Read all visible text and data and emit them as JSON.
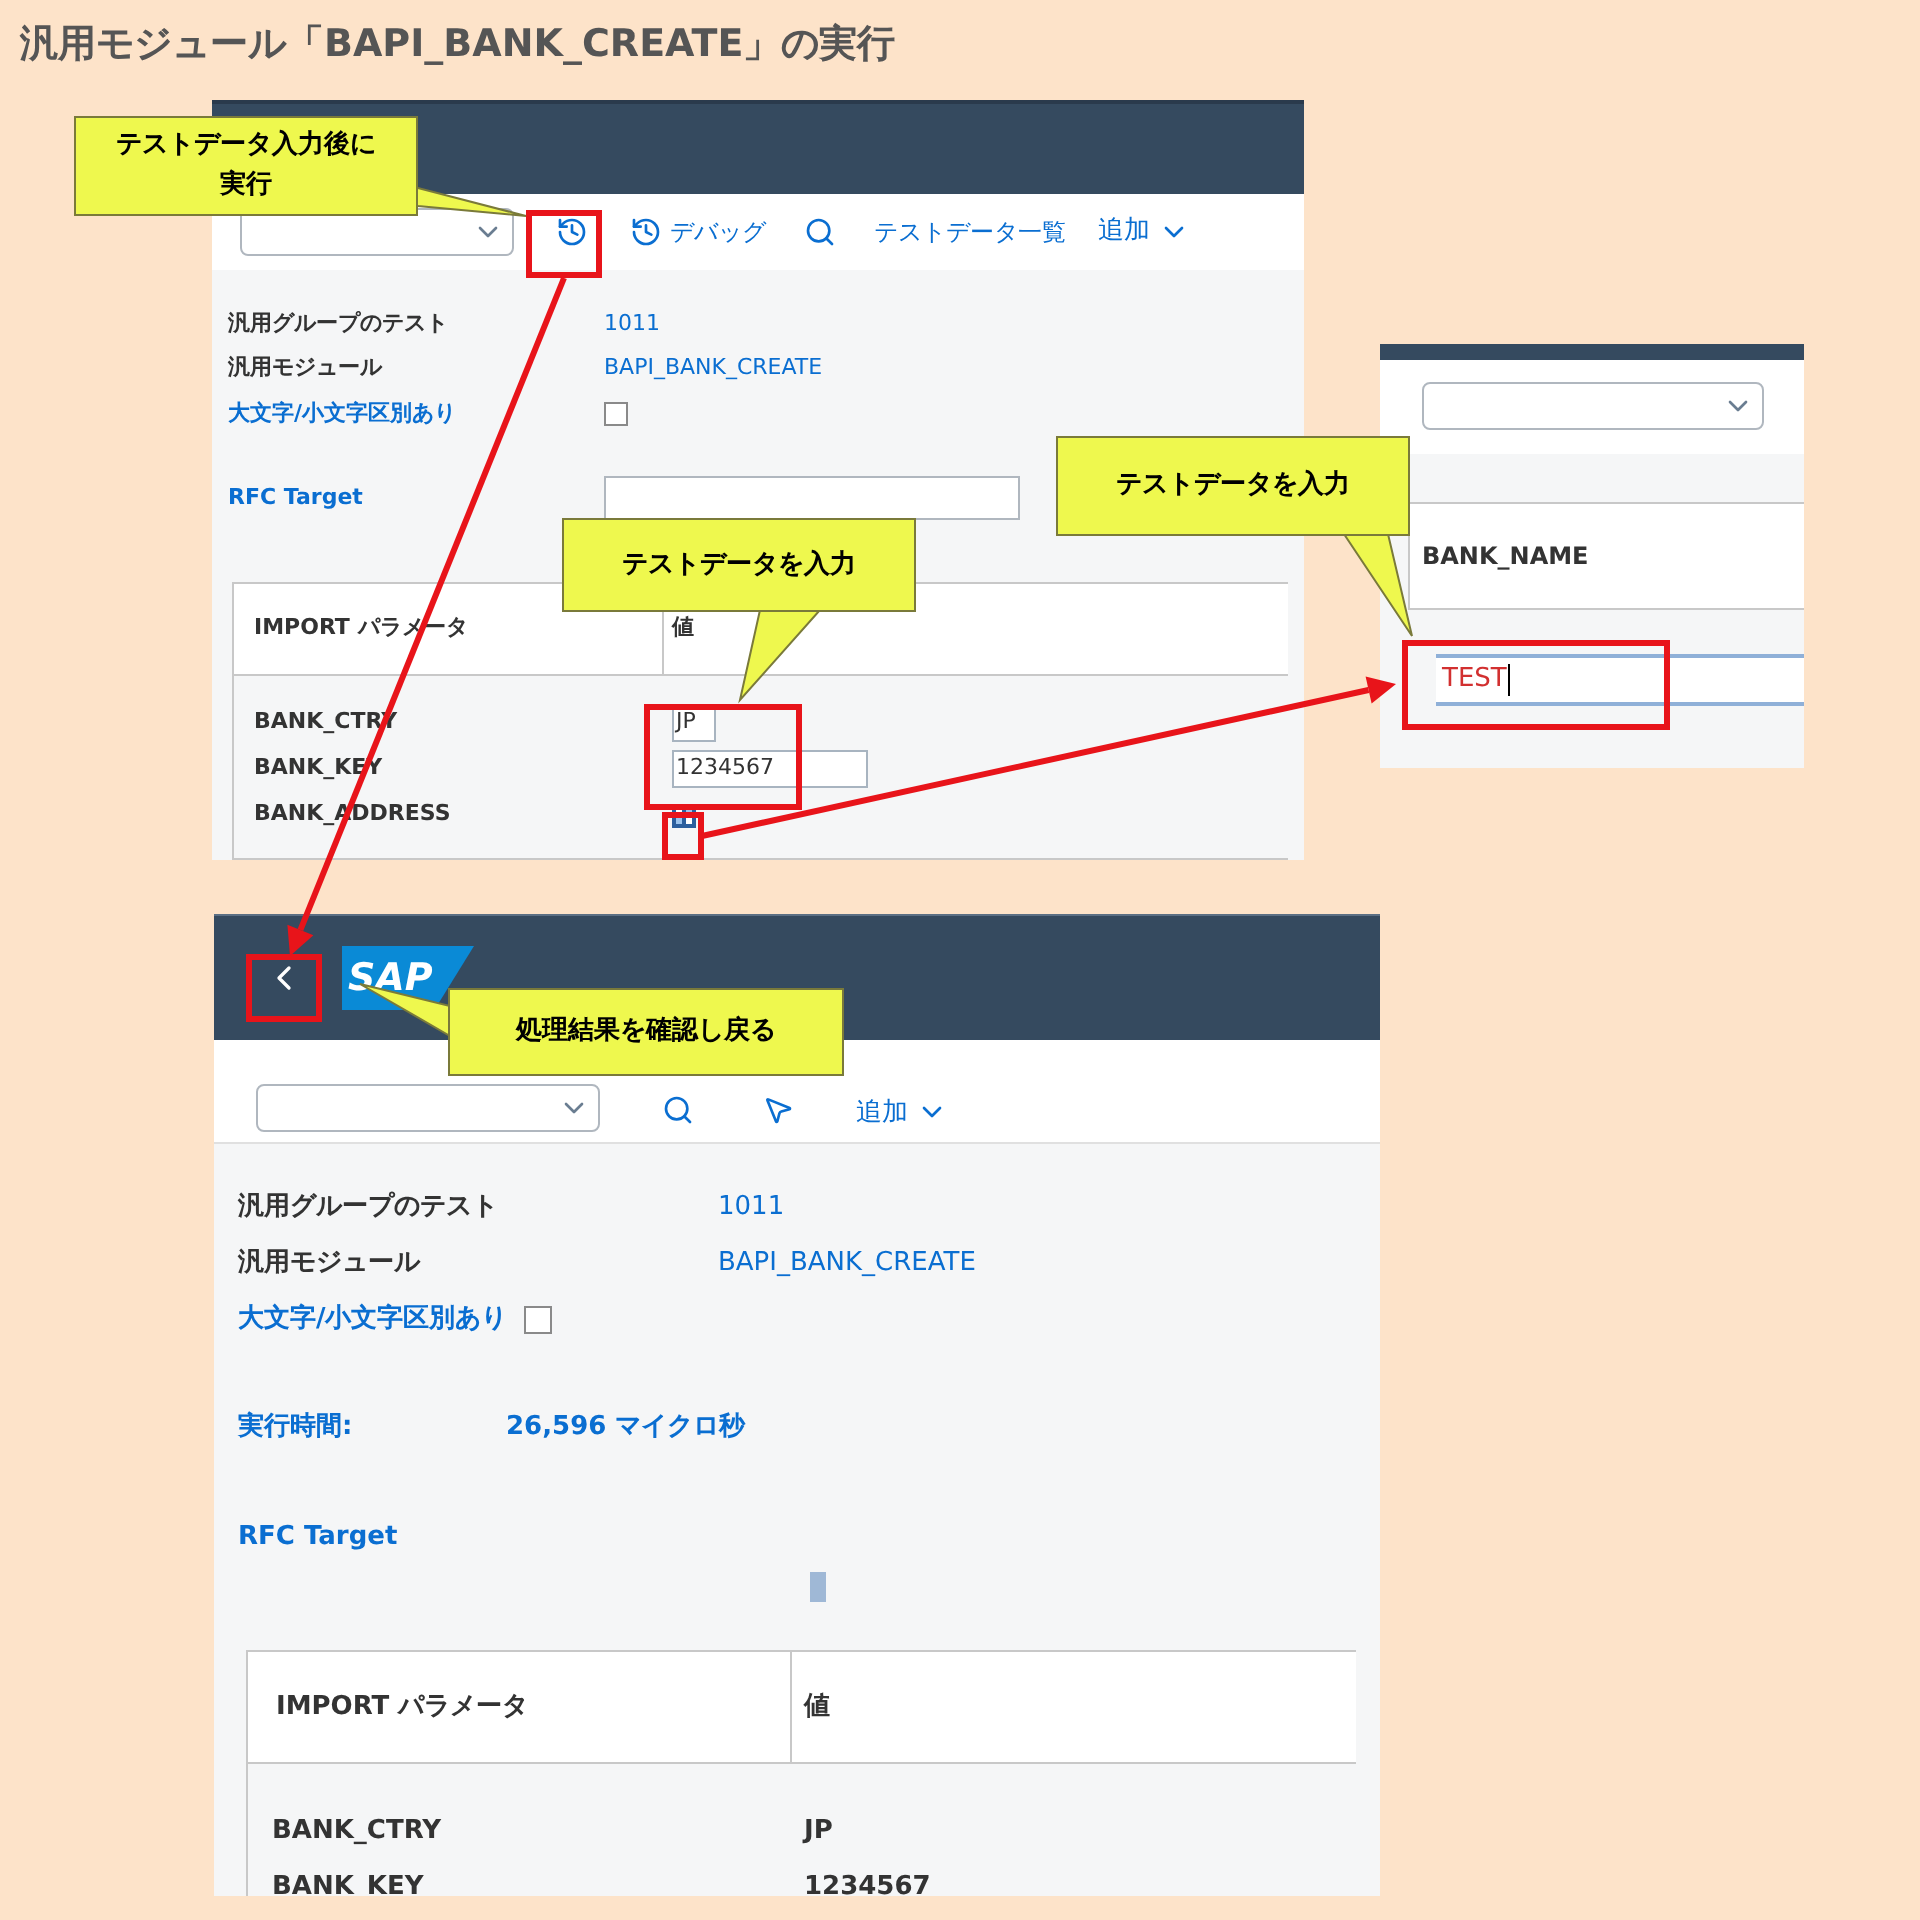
{
  "title": "汎用モジュール「BAPI_BANK_CREATE」の実行",
  "before_screen": {
    "toolbar": [
      {
        "kind": "dropdown"
      },
      {
        "kind": "execute"
      },
      {
        "kind": "debug",
        "label": "デバッグ"
      },
      {
        "kind": "search"
      },
      {
        "kind": "text",
        "label": "テストデータ一覧"
      },
      {
        "kind": "menu",
        "label": "追加"
      }
    ],
    "fields": [
      {
        "label": "汎用グループのテスト",
        "value": "1011"
      },
      {
        "label": "汎用モジュール",
        "value": "BAPI_BANK_CREATE"
      }
    ],
    "case_checkbox": {
      "label": "大文字/小文字区別あり",
      "checked": false
    },
    "rfc_target": {
      "label": "RFC Target"
    },
    "table": {
      "columns": [
        "IMPORT パラメータ",
        "値"
      ],
      "rows": [
        {
          "name": "BANK_CTRY",
          "kind": "input",
          "value": "JP"
        },
        {
          "name": "BANK_KEY",
          "kind": "input",
          "value": "1234567"
        },
        {
          "name": "BANK_ADDRESS",
          "kind": "structure"
        }
      ]
    }
  },
  "structure_screen": {
    "column": "BANK_NAME",
    "value": "TEST"
  },
  "result_screen": {
    "logo": "SAP",
    "toolbar": [
      {
        "kind": "dropdown"
      },
      {
        "kind": "search"
      },
      {
        "kind": "pointer"
      },
      {
        "kind": "menu",
        "label": "追加"
      }
    ],
    "fields": [
      {
        "label": "汎用グループのテスト",
        "value": "1011"
      },
      {
        "label": "汎用モジュール",
        "value": "BAPI_BANK_CREATE"
      }
    ],
    "case_checkbox": {
      "label": "大文字/小文字区別あり",
      "checked": false
    },
    "runtime": {
      "label": "実行時間:",
      "value": "26,596 マイクロ秒"
    },
    "rfc_target": {
      "label": "RFC Target"
    },
    "table": {
      "columns": [
        "IMPORT パラメータ",
        "値"
      ],
      "rows": [
        {
          "name": "BANK_CTRY",
          "value": "JP"
        },
        {
          "name": "BANK_KEY",
          "value": "1234567"
        }
      ]
    }
  },
  "callouts": [
    {
      "lines": [
        "テストデータ入力後に",
        "実行"
      ]
    },
    {
      "lines": [
        "テストデータを入力"
      ]
    },
    {
      "lines": [
        "テストデータを入力"
      ]
    },
    {
      "lines": [
        "処理結果を確認し戻る"
      ]
    }
  ]
}
